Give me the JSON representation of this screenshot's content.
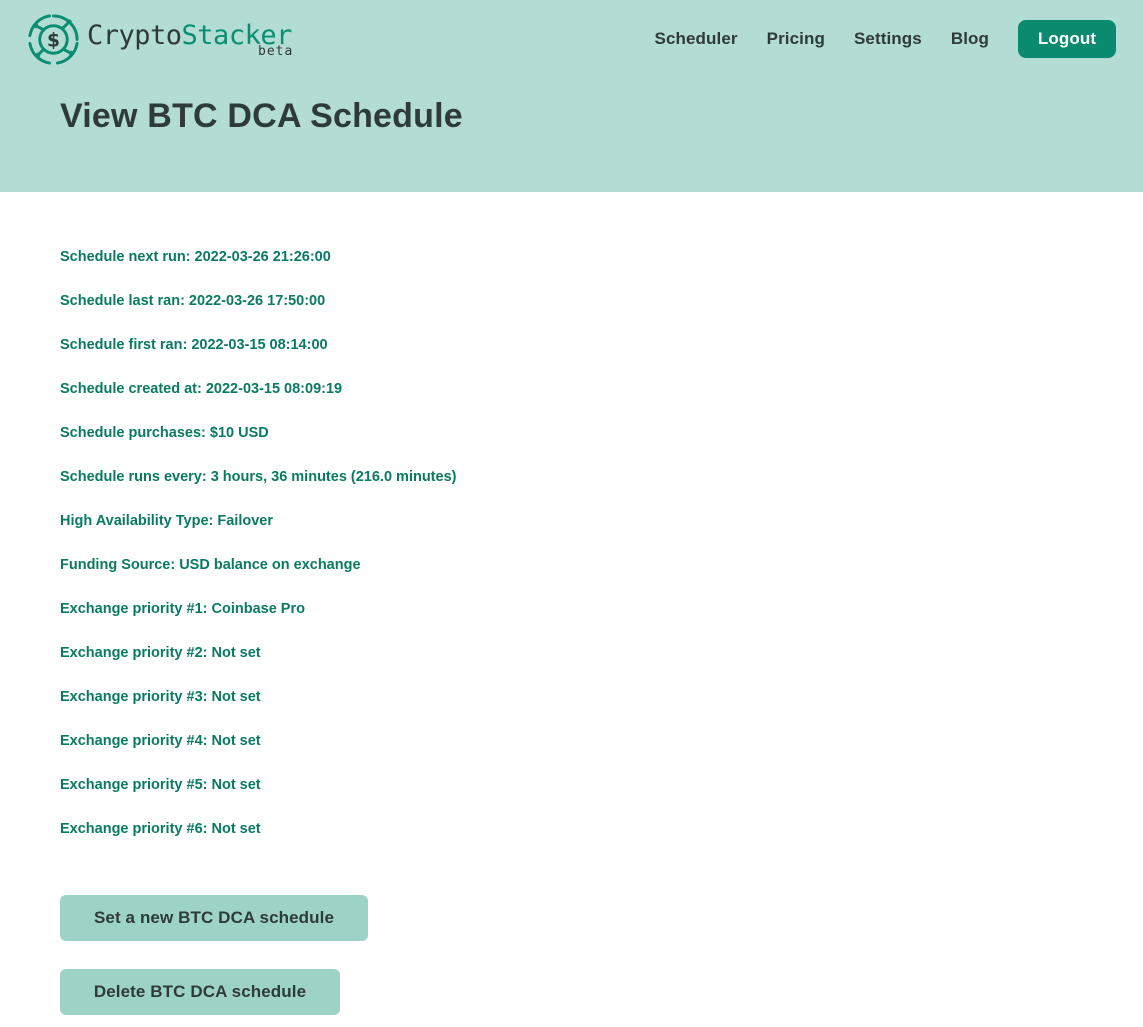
{
  "brand": {
    "name_part1": "Crypto",
    "name_part2": "Stacker",
    "tag": "beta",
    "colors": {
      "dark": "#2f3a3a",
      "accent": "#0a8e72",
      "header_bg": "#b3dcd4"
    },
    "icon": "coin-circuit-icon"
  },
  "nav": {
    "items": [
      {
        "label": "Scheduler"
      },
      {
        "label": "Pricing"
      },
      {
        "label": "Settings"
      },
      {
        "label": "Blog"
      }
    ],
    "logout_label": "Logout"
  },
  "page": {
    "title": "View BTC DCA Schedule"
  },
  "schedule": {
    "details": [
      "Schedule next run: 2022-03-26 21:26:00",
      "Schedule last ran: 2022-03-26 17:50:00",
      "Schedule first ran: 2022-03-15 08:14:00",
      "Schedule created at: 2022-03-15 08:09:19",
      "Schedule purchases: $10 USD",
      "Schedule runs every: 3 hours, 36 minutes (216.0 minutes)",
      "High Availability Type: Failover",
      "Funding Source: USD balance on exchange",
      "Exchange priority #1: Coinbase Pro",
      "Exchange priority #2: Not set",
      "Exchange priority #3: Not set",
      "Exchange priority #4: Not set",
      "Exchange priority #5: Not set",
      "Exchange priority #6: Not set"
    ]
  },
  "actions": {
    "new_schedule_label": "Set a new BTC DCA schedule",
    "delete_schedule_label": "Delete BTC DCA schedule"
  }
}
